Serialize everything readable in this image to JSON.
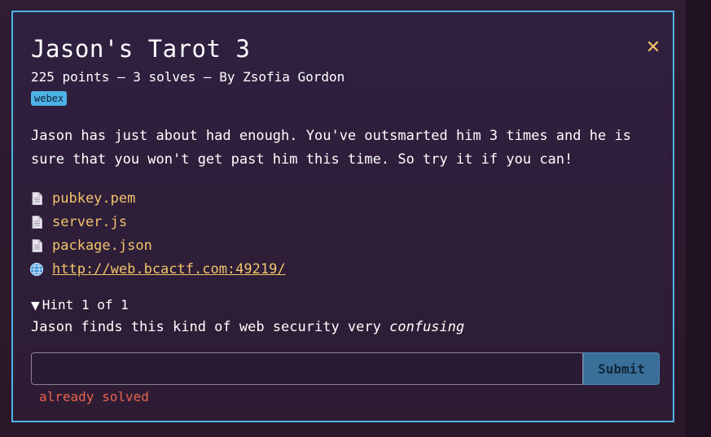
{
  "challenge": {
    "title": "Jason's Tarot 3",
    "meta": "225 points – 3 solves – By Zsofia Gordon",
    "tag": "webex",
    "description": "Jason has just about had enough. You've outsmarted him 3 times and he is sure that you won't get past him this time. So try it if you can!",
    "files": [
      {
        "label": "pubkey.pem",
        "icon": "document-icon"
      },
      {
        "label": "server.js",
        "icon": "document-icon"
      },
      {
        "label": "package.json",
        "icon": "document-icon"
      },
      {
        "label": "http://web.bcactf.com:49219/",
        "icon": "globe-icon"
      }
    ],
    "hint": {
      "header": "Hint 1 of 1",
      "text_prefix": "Jason finds this kind of web security very",
      "text_emphasis": "confusing"
    },
    "flag_input": {
      "value": "",
      "placeholder": ""
    },
    "submit_label": "Submit",
    "status": "already solved"
  },
  "colors": {
    "accent_border": "#4db3e6",
    "link": "#f2c46b",
    "close": "#f2c46b",
    "status_error": "#e8634f",
    "submit_bg": "#3a6f98"
  }
}
